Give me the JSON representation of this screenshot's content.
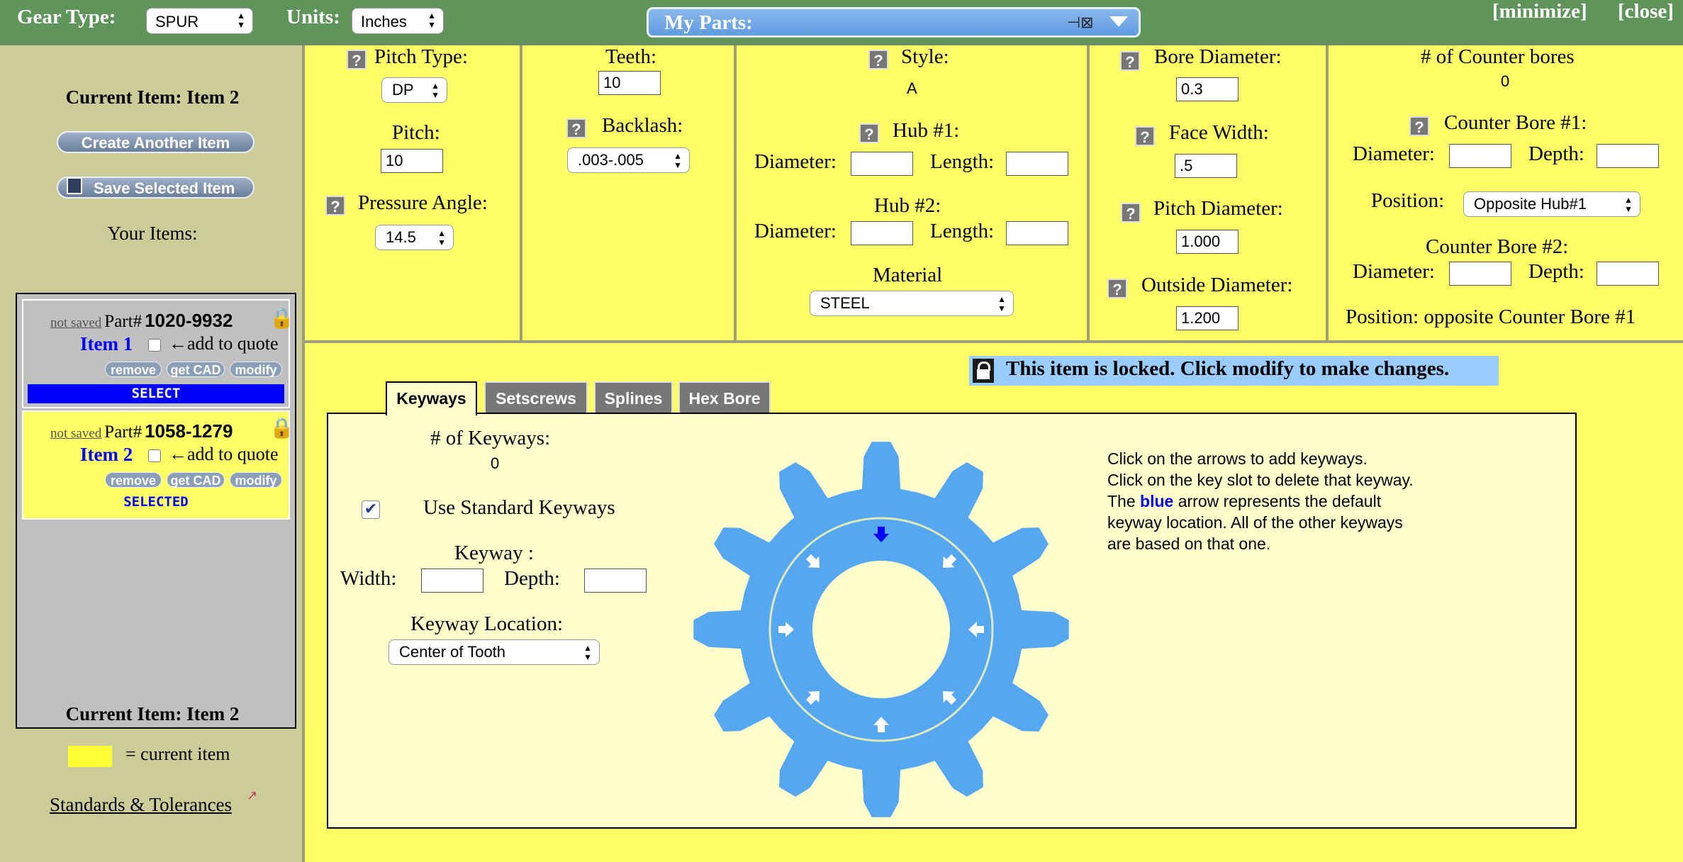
{
  "topbar": {
    "gear_type_label": "Gear Type:",
    "gear_type_value": "SPUR",
    "units_label": "Units:",
    "units_value": "Inches",
    "my_parts_label": "My Parts:",
    "minimize_label": "[minimize]",
    "close_label": "[close]"
  },
  "sidebar": {
    "current_item_top": "Current Item: Item 2",
    "create_button": "Create Another Item",
    "save_button": "Save Selected Item",
    "your_items_label": "Your Items:",
    "items": [
      {
        "status": "not saved",
        "part_prefix": "Part#",
        "part_number": "1020-9932",
        "name": "Item 1",
        "add_to_quote": "←add to quote",
        "remove": "remove",
        "get_cad": "get CAD",
        "modify": "modify",
        "select_label": "SELECT"
      },
      {
        "status": "not saved",
        "part_prefix": "Part#",
        "part_number": "1058-1279",
        "name": "Item 2",
        "add_to_quote": "←add to quote",
        "remove": "remove",
        "get_cad": "get CAD",
        "modify": "modify",
        "select_label": "SELECTED"
      }
    ],
    "current_item_bottom": "Current Item: Item 2",
    "legend_text": "= current item",
    "standards_link": "Standards & Tolerances"
  },
  "pitch": {
    "pitch_type_label": "Pitch Type:",
    "pitch_type_value": "DP",
    "pitch_label": "Pitch:",
    "pitch_value": "10",
    "pressure_angle_label": "Pressure Angle:",
    "pressure_angle_value": "14.5"
  },
  "teeth": {
    "teeth_label": "Teeth:",
    "teeth_value": "10",
    "backlash_label": "Backlash:",
    "backlash_value": ".003-.005"
  },
  "style": {
    "style_label": "Style:",
    "style_value": "A",
    "hub1_label": "Hub #1:",
    "hub2_label": "Hub #2:",
    "diameter_label": "Diameter:",
    "length_label": "Length:",
    "material_label": "Material",
    "material_value": "STEEL"
  },
  "dimensions": {
    "bore_label": "Bore Diameter:",
    "bore_value": "0.3",
    "face_label": "Face Width:",
    "face_value": ".5",
    "pitch_diameter_label": "Pitch Diameter:",
    "pitch_diameter_value": "1.000",
    "outside_label": "Outside Diameter:",
    "outside_value": "1.200"
  },
  "counterbores": {
    "count_label": "# of Counter bores",
    "count_value": "0",
    "cb1_label": "Counter Bore #1:",
    "diameter_label": "Diameter:",
    "depth_label": "Depth:",
    "position_label": "Position:",
    "position_value": "Opposite Hub#1",
    "cb2_label": "Counter Bore #2:",
    "position2_text": "Position: opposite Counter Bore #1"
  },
  "lock_message": "This item is locked. Click modify to make changes.",
  "tabs": [
    "Keyways",
    "Setscrews",
    "Splines",
    "Hex Bore"
  ],
  "keyways": {
    "count_label": "# of Keyways:",
    "count_value": "0",
    "use_standard_label": "Use Standard Keyways",
    "keyway_label": "Keyway :",
    "width_label": "Width:",
    "depth_label": "Depth:",
    "location_label": "Keyway Location:",
    "location_value": "Center of Tooth"
  },
  "instructions": {
    "line1": "Click on the arrows to add keyways.",
    "line2": "Click on the key slot to delete that keyway.",
    "line3_pre": "The ",
    "line3_blue": "blue",
    "line3_post": " arrow represents the default",
    "line4": "keyway location. All of the other keyways",
    "line5": "are based on that one."
  },
  "colors": {
    "topbar_green": "#5f955b",
    "panel_yellow": "#ffff66",
    "sidebar_tan": "#cccc99",
    "gear_blue": "#55a7f2",
    "default_arrow_blue": "#0000ff"
  }
}
